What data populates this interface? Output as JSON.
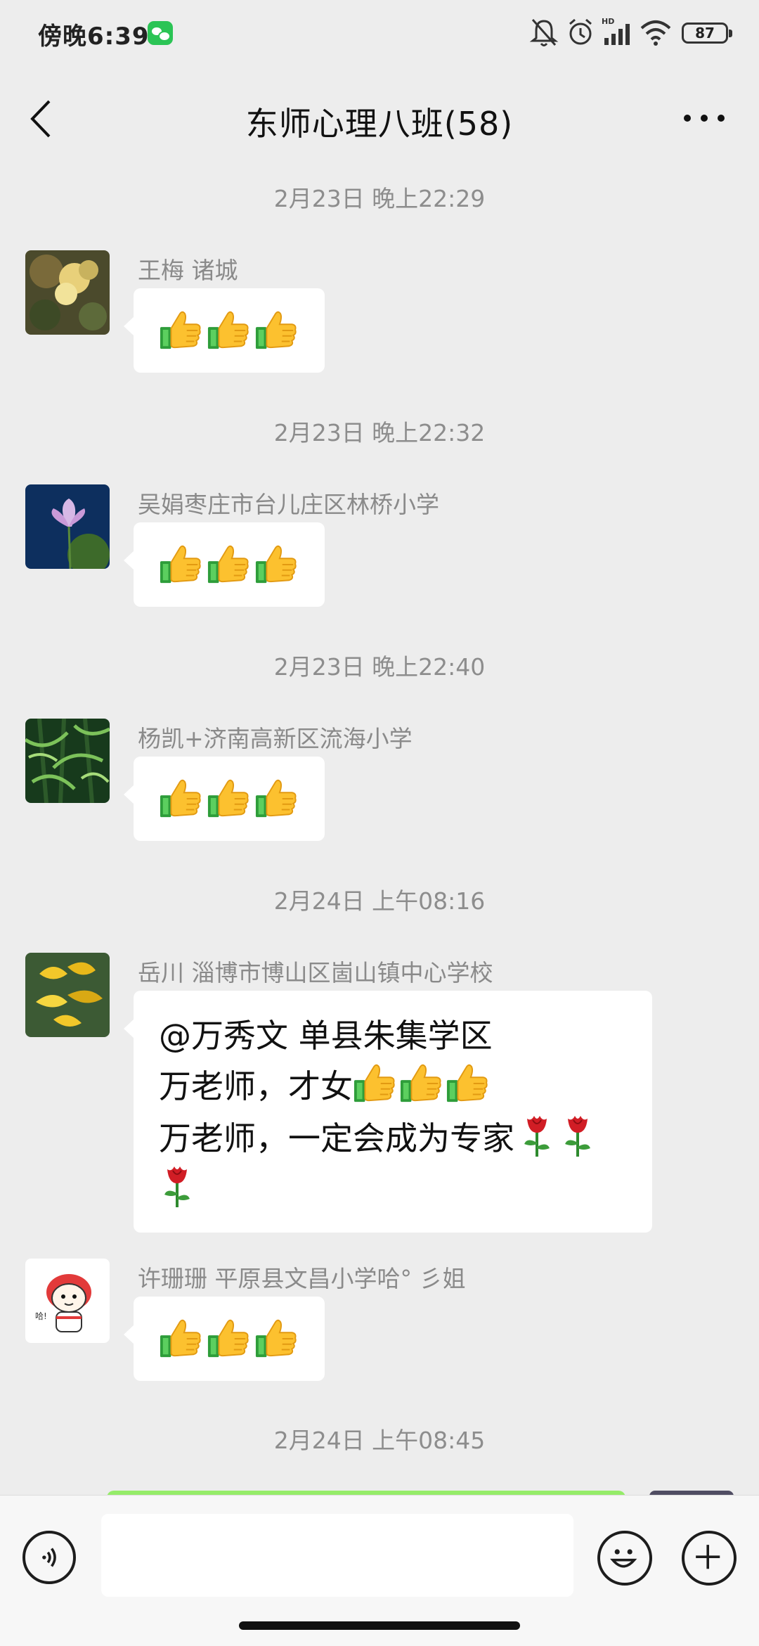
{
  "status_bar": {
    "time": "傍晚6:39",
    "battery": "87",
    "icons": [
      "wechat-icon",
      "mute-icon",
      "alarm-icon",
      "hd-signal-icon",
      "wifi-icon",
      "battery-icon"
    ]
  },
  "header": {
    "title": "东师心理八班(58)",
    "back_icon": "chevron-left-icon",
    "more_icon": "more-icon"
  },
  "messages": [
    {
      "timestamp": "2月23日 晚上22:29",
      "sender": "王梅 诸城",
      "avatar": "yellow-flowers",
      "content": "thumbs-up x3"
    },
    {
      "timestamp": "2月23日 晚上22:32",
      "sender": "吴娟枣庄市台儿庄区林桥小学",
      "avatar": "lotus",
      "content": "thumbs-up x3"
    },
    {
      "timestamp": "2月23日 晚上22:40",
      "sender": "杨凯+济南高新区流海小学",
      "avatar": "bamboo",
      "content": "thumbs-up x3"
    },
    {
      "timestamp": "2月24日 上午08:16",
      "sender": "岳川 淄博市博山区崮山镇中心学校",
      "avatar": "ginkgo-leaves",
      "lines": [
        "@万秀文  单县朱集学区",
        "万老师，才女",
        "万老师，一定会成为专家"
      ]
    },
    {
      "sender": "许珊珊 平原县文昌小学哈°  彡姐",
      "avatar": "lion-dance-cartoon",
      "content": "thumbs-up x3"
    },
    {
      "timestamp": "2月24日 上午08:45"
    }
  ],
  "input_bar": {
    "placeholder": "",
    "voice_icon": "voice-icon",
    "emoji_icon": "emoji-icon",
    "plus_icon": "plus-icon"
  },
  "colors": {
    "background": "#ededed",
    "bubble": "#ffffff",
    "sent_bubble": "#95ec69",
    "timestamp": "#8d8d8d"
  }
}
